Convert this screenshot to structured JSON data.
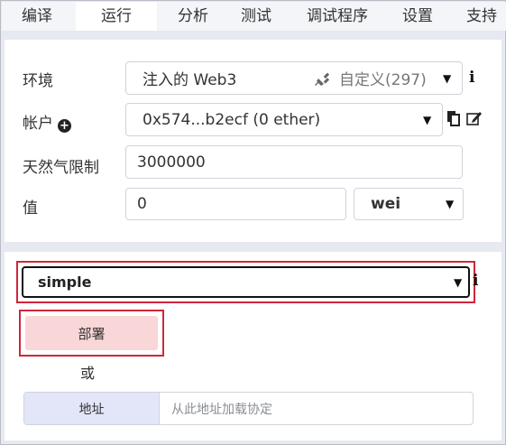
{
  "tabs": [
    "编译",
    "运行",
    "分析",
    "测试",
    "调试程序",
    "设置",
    "支持"
  ],
  "active_tab": "运行",
  "environment": {
    "label": "环境",
    "value": "注入的 Web3",
    "network": "自定义(297)",
    "plug_icon": "plug-icon",
    "info_icon": "info-icon"
  },
  "account": {
    "label": "帐户",
    "add_icon": "plus-circle-icon",
    "value": "0x574...b2ecf (0 ether)",
    "copy_icon": "copy-icon",
    "edit_icon": "edit-icon"
  },
  "gas_limit": {
    "label": "天然气限制",
    "value": "3000000"
  },
  "value": {
    "label": "值",
    "amount": "0",
    "unit": "wei"
  },
  "contract": {
    "selected": "simple",
    "info_icon": "info-icon"
  },
  "deploy_label": "部署",
  "or_label": "或",
  "at_address": {
    "button": "地址",
    "placeholder": "从此地址加载协定"
  },
  "colors": {
    "highlight": "#d0263a",
    "deploy_bg": "#f9d6d7",
    "address_bg": "#e2e6f8"
  }
}
